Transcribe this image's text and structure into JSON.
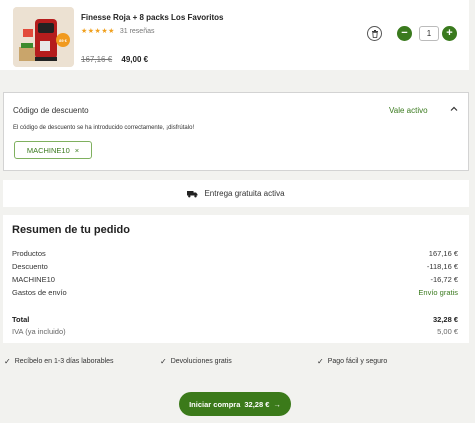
{
  "product": {
    "name": "Finesse Roja + 8 packs Los Favoritos",
    "stars": "★★★★★",
    "reviews": "31 reseñas",
    "old_price": "167,16 €",
    "new_price": "49,00 €",
    "badge": "89 €",
    "quantity": "1",
    "rating_value": 5
  },
  "discount": {
    "title": "Código de descuento",
    "status": "Vale activo",
    "message": "El código de descuento se ha introducido correctamente, ¡disfrútalo!",
    "code": "MACHINE10",
    "remove_glyph": "×"
  },
  "shipping": {
    "label": "Entrega gratuita activa"
  },
  "summary": {
    "title": "Resumen de tu pedido",
    "products_label": "Productos",
    "products_value": "167,16 €",
    "discount_label": "Descuento",
    "discount_value": "-118,16 €",
    "code_label": "MACHINE10",
    "code_value": "-16,72 €",
    "shipping_label": "Gastos de envío",
    "shipping_value": "Envío gratis",
    "total_label": "Total",
    "total_value": "32,28 €",
    "vat_label": "IVA (ya incluido)",
    "vat_value": "5,00 €"
  },
  "benefits": [
    "Recíbelo en 1-3 días laborables",
    "Devoluciones gratis",
    "Pago fácil y seguro"
  ],
  "cta": {
    "label": "Iniciar compra",
    "amount": "32,28 €",
    "arrow": "→"
  },
  "colors": {
    "accent_green": "#3a7a1e",
    "star_orange": "#f0a01e",
    "background": "#f2f2ef"
  }
}
